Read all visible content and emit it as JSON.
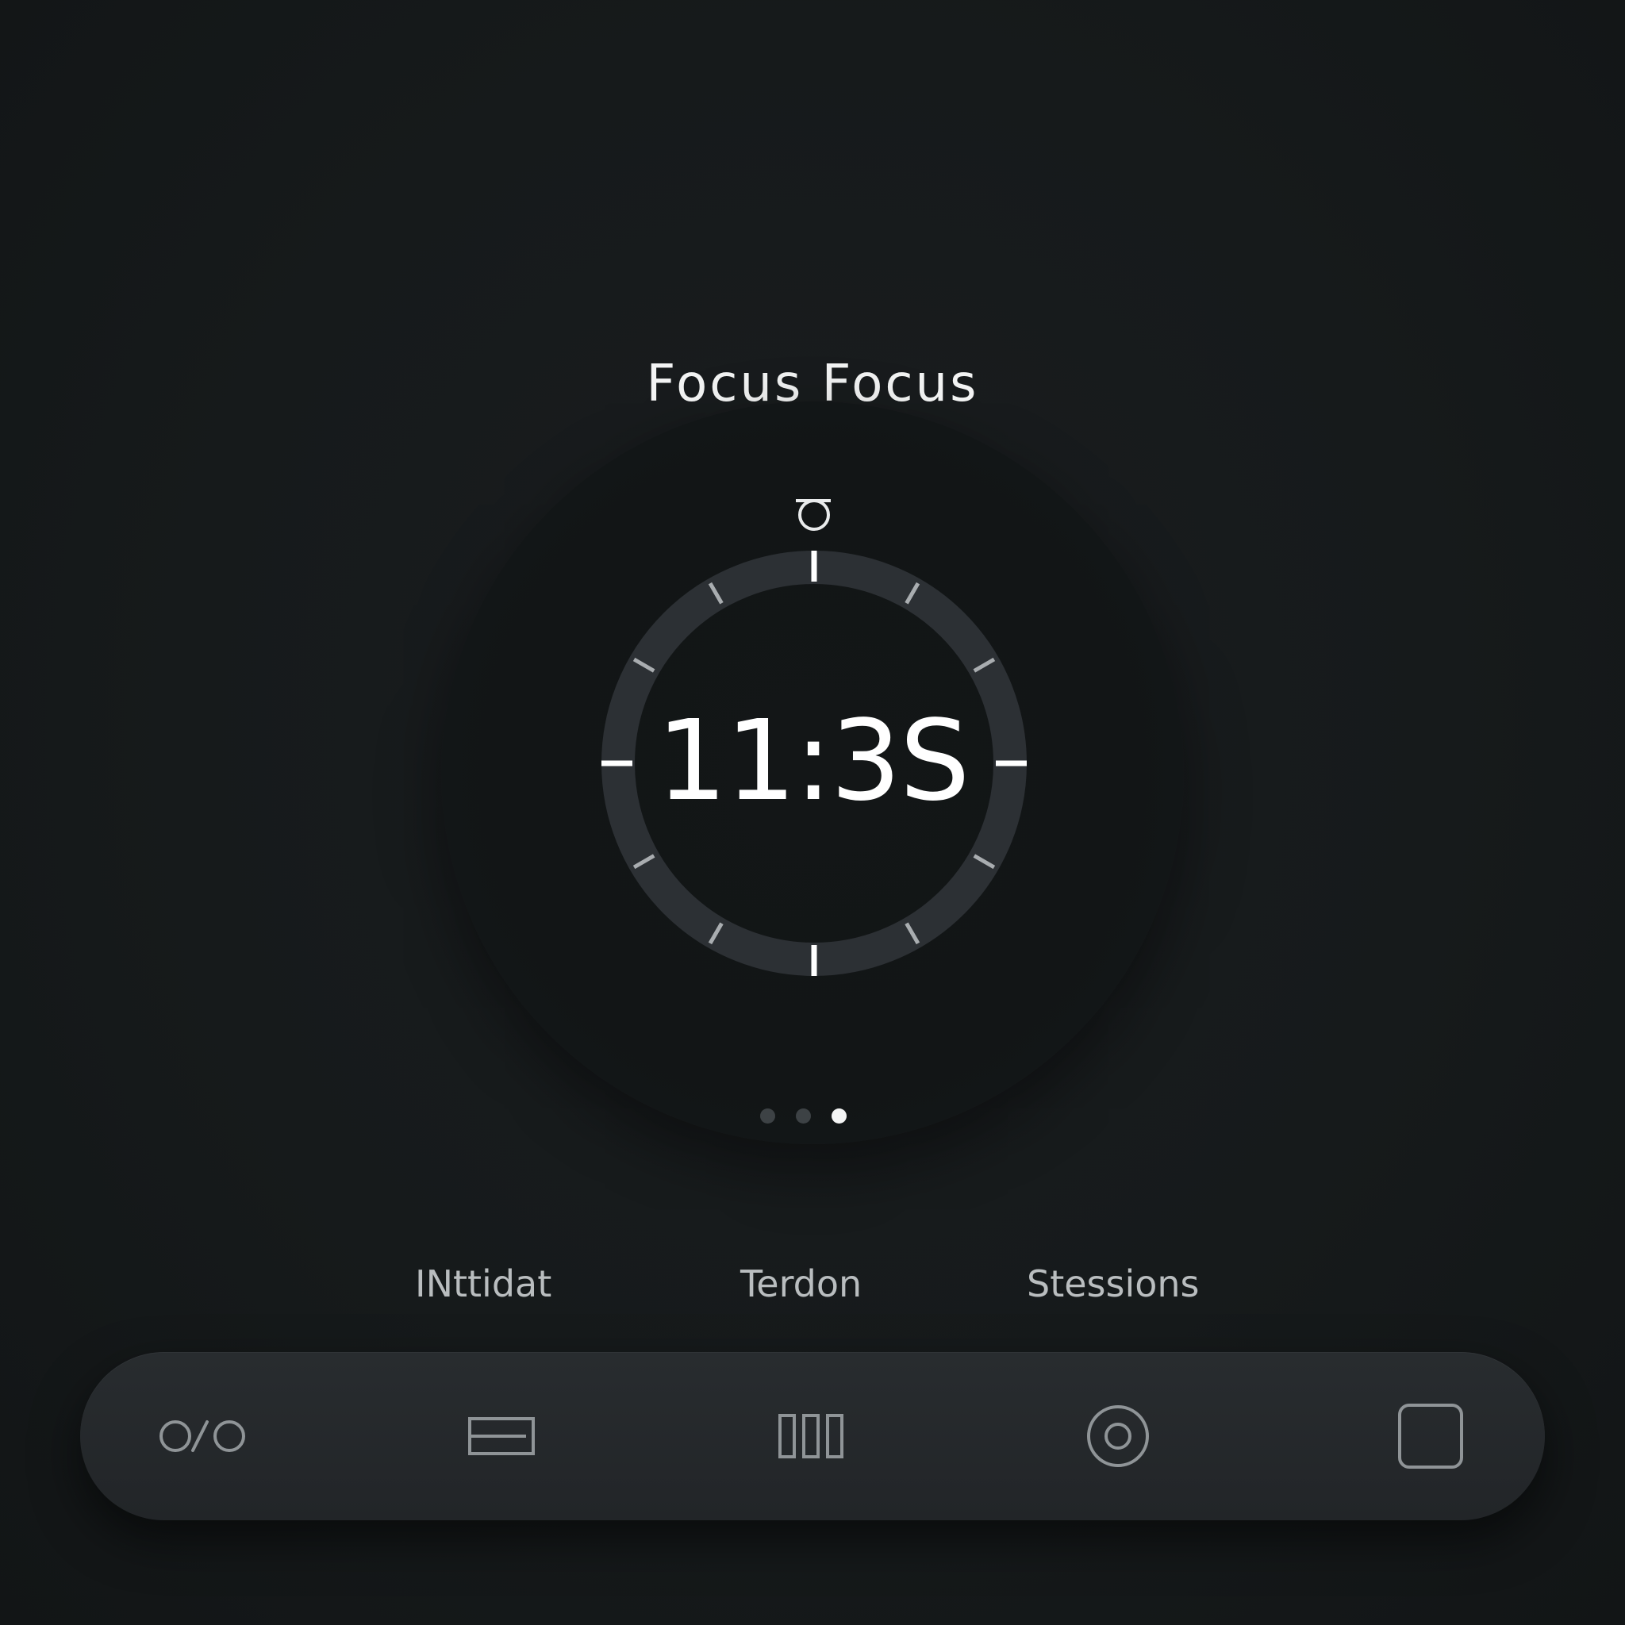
{
  "screen": {
    "title": "Focus Focus"
  },
  "timer": {
    "display": "11:3S",
    "tick_count": 12,
    "colors": {
      "ring": "#2c3034",
      "major_tick": "#ffffff",
      "minor_tick": "#a9adb0"
    }
  },
  "pager": {
    "page_count": 3,
    "active_page": 3
  },
  "stats": {
    "labels": [
      "INttidat",
      "Terdon",
      "Stessions"
    ]
  },
  "tabbar": {
    "tabs": [
      {
        "icon": "toggle-icon"
      },
      {
        "icon": "stack-icon"
      },
      {
        "icon": "columns-icon"
      },
      {
        "icon": "target-icon"
      },
      {
        "icon": "square-icon"
      }
    ],
    "icon_color": "#8f9497"
  }
}
